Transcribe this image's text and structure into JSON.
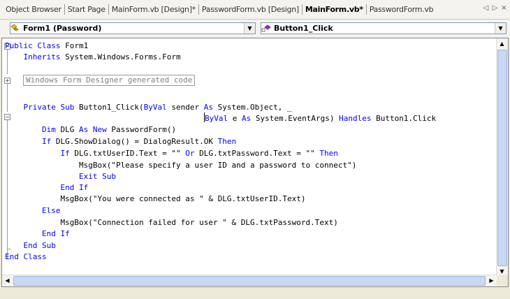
{
  "tabs": [
    {
      "label": "Object Browser"
    },
    {
      "label": "Start Page"
    },
    {
      "label": "MainForm.vb [Design]*"
    },
    {
      "label": "PasswordForm.vb [Design]"
    },
    {
      "label": "MainForm.vb*"
    },
    {
      "label": "PasswordForm.vb"
    }
  ],
  "tab_controls": {
    "prev": "◁",
    "next": "▷",
    "close": "×"
  },
  "class_combo": {
    "value": "Form1 (Password)"
  },
  "method_combo": {
    "value": "Button1_Click"
  },
  "code": {
    "l1a": "Public Class",
    "l1b": " Form1",
    "l2a": "    Inherits",
    "l2b": " System.Windows.Forms.Form",
    "region": "Windows Form Designer generated code",
    "l3a": "    Private Sub",
    "l3b": " Button1_Click(",
    "l3c": "ByVal",
    "l3d": " sender ",
    "l3e": "As",
    "l3f": " System.Object, _",
    "l4a": "ByVal",
    "l4b": " e ",
    "l4c": "As",
    "l4d": " System.EventArgs) ",
    "l4e": "Handles",
    "l4f": " Button1.Click",
    "l5a": "        Dim",
    "l5b": " DLG ",
    "l5c": "As New",
    "l5d": " PasswordForm()",
    "l6a": "        If",
    "l6b": " DLG.ShowDialog() = DialogResult.OK ",
    "l6c": "Then",
    "l7a": "            If",
    "l7b": " DLG.txtUserID.Text = \"\" ",
    "l7c": "Or",
    "l7d": " DLG.txtPassword.Text = \"\" ",
    "l7e": "Then",
    "l8": "                MsgBox(\"Please specify a user ID and a password to connect\")",
    "l9": "                Exit Sub",
    "l10": "            End If",
    "l11": "            MsgBox(\"You were connected as \" & DLG.txtUserID.Text)",
    "l12": "        Else",
    "l13": "            MsgBox(\"Connection failed for user \" & DLG.txtPassword.Text)",
    "l14": "        End If",
    "l15": "    End Sub",
    "l16": "End Class"
  },
  "colors": {
    "keyword": "#0000ff",
    "text": "#000000",
    "region": "#7f7f7f"
  },
  "icons": {
    "class_icon": "class-icon",
    "method_icon": "method-icon"
  }
}
